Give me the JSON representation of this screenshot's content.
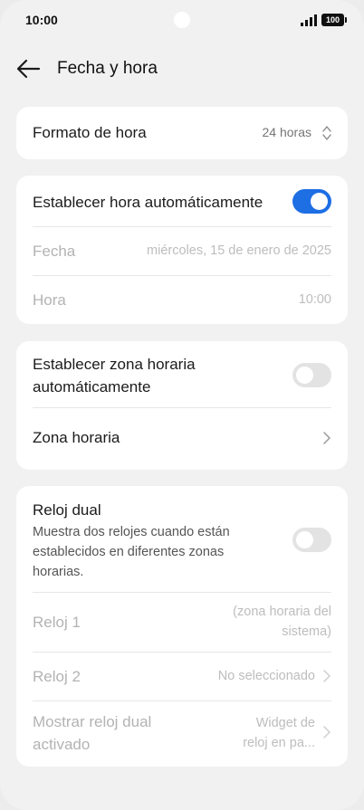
{
  "status": {
    "time": "10:00",
    "battery": "100"
  },
  "header": {
    "title": "Fecha y hora"
  },
  "time_format": {
    "label": "Formato de hora",
    "value": "24 horas"
  },
  "auto_time": {
    "label": "Establecer hora automáticamente",
    "enabled": true,
    "date_label": "Fecha",
    "date_value": "miércoles, 15 de enero de 2025",
    "time_label": "Hora",
    "time_value": "10:00"
  },
  "timezone": {
    "auto_label_line1": "Establecer zona horaria",
    "auto_label_line2": "automáticamente",
    "auto_enabled": false,
    "zone_label": "Zona horaria"
  },
  "dual_clock": {
    "title": "Reloj dual",
    "desc_line1": "Muestra dos relojes cuando están",
    "desc_line2": "establecidos en diferentes zonas",
    "desc_line3": "horarias.",
    "enabled": false,
    "clock1_label": "Reloj 1",
    "clock1_value_line1": "(zona horaria del",
    "clock1_value_line2": "sistema)",
    "clock2_label": "Reloj 2",
    "clock2_value": "No seleccionado",
    "show_label_line1": "Mostrar reloj dual",
    "show_label_line2": "activado",
    "show_value_line1": "Widget de",
    "show_value_line2": "reloj en pa..."
  },
  "colors": {
    "accent": "#1e6ee4",
    "background": "#f1f1f1",
    "card": "#ffffff"
  }
}
